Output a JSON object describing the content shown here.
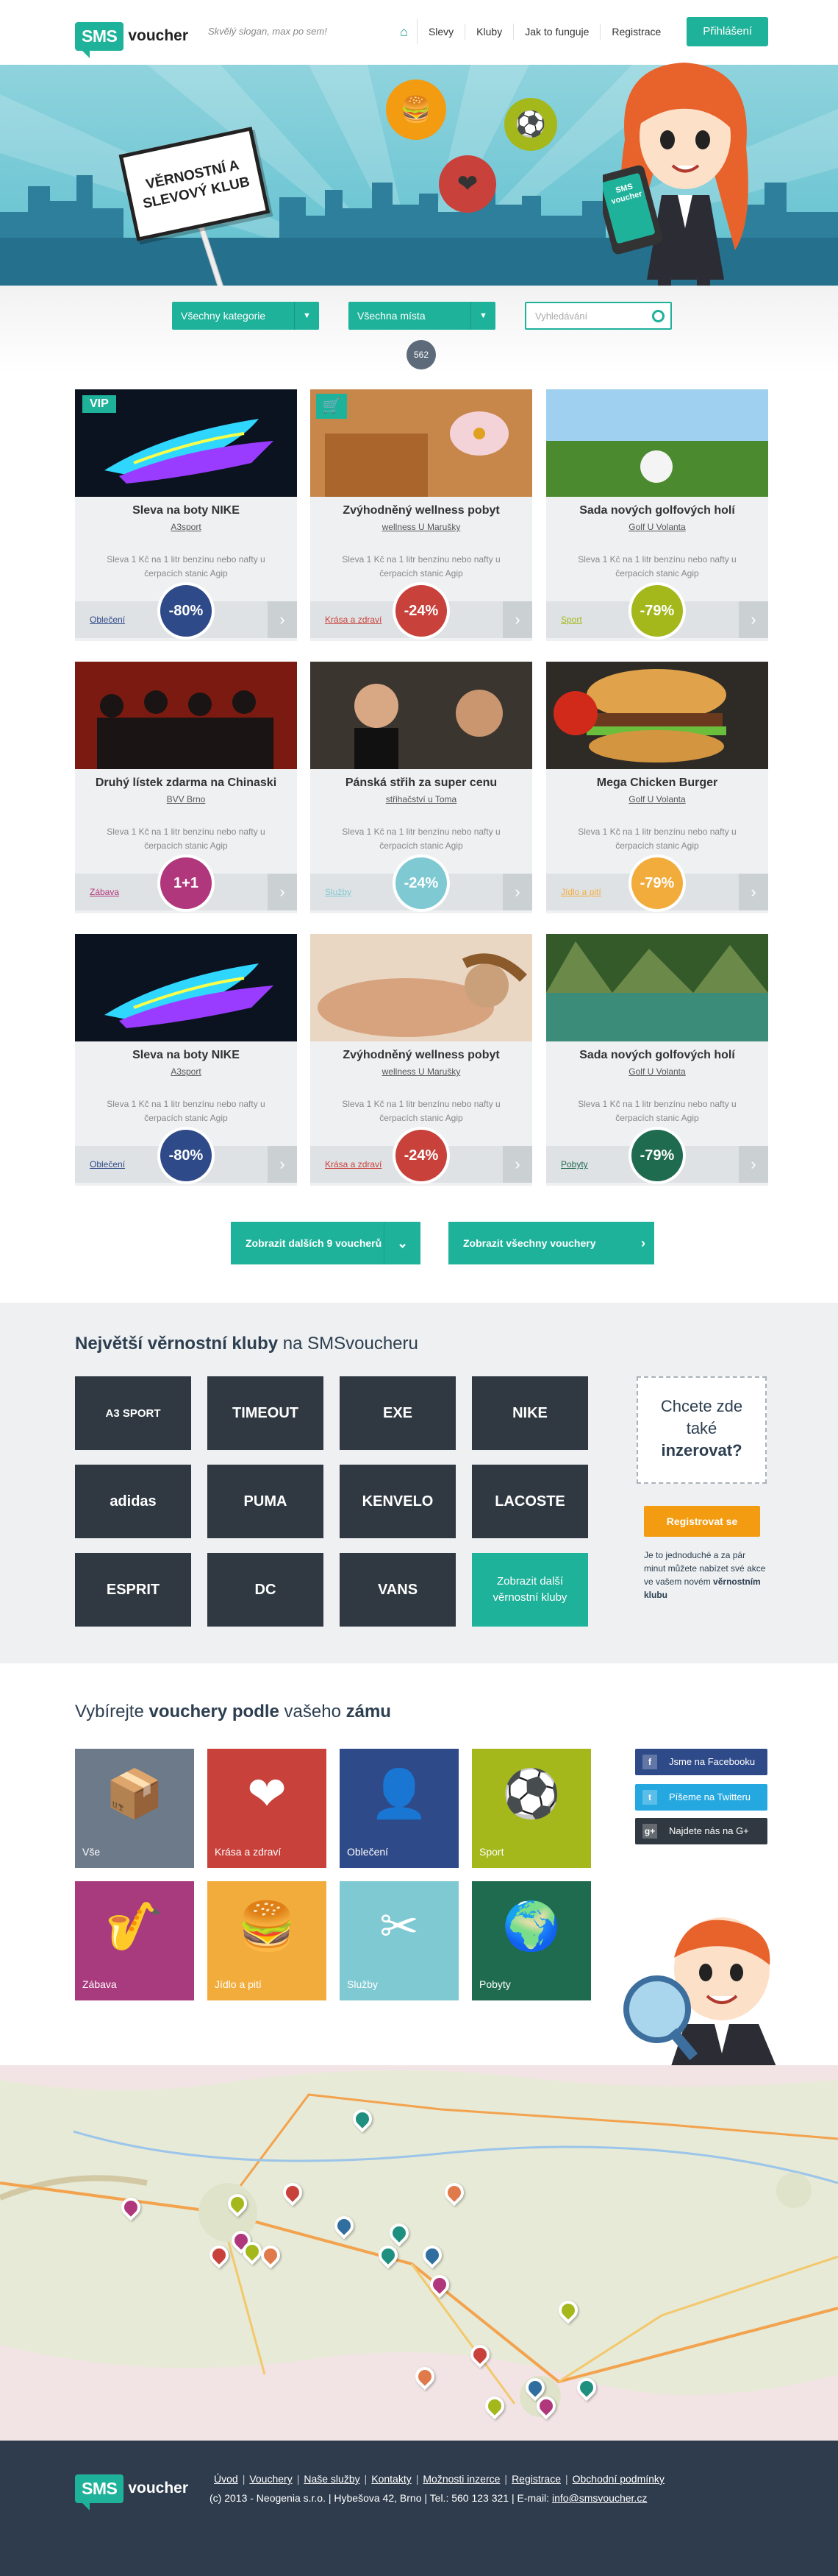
{
  "header": {
    "logo_sms": "SMS",
    "logo_voucher": "voucher",
    "slogan": "Skvělý slogan, max po sem!",
    "nav": [
      "Slevy",
      "Kluby",
      "Jak to funguje",
      "Registrace"
    ],
    "login": "Přihlášení"
  },
  "hero": {
    "sign_line1": "VĚRNOSTNÍ A",
    "sign_line2": "SLEVOVÝ KLUB",
    "phone_sms": "SMS",
    "phone_voucher": "voucher"
  },
  "filters": {
    "categories": "Všechny kategorie",
    "places": "Všechna místa",
    "search_placeholder": "Vyhledávání",
    "count": "562"
  },
  "cards": [
    {
      "title": "Sleva na boty NIKE",
      "shop": "A3sport",
      "desc": "Sleva 1 Kč na 1 litr benzínu nebo nafty u čerpacích stanic Agip",
      "category": "Oblečení",
      "discount": "-80%",
      "color": "#2f4a88",
      "badge": "VIP",
      "img": "nike"
    },
    {
      "title": "Zvýhodněný wellness pobyt",
      "shop": "wellness U Marušky",
      "desc": "Sleva 1 Kč na 1 litr benzínu nebo nafty u čerpacích stanic Agip",
      "category": "Krása a zdraví",
      "discount": "-24%",
      "color": "#c8413b",
      "badge": "cart",
      "img": "spa"
    },
    {
      "title": "Sada nových golfových holí",
      "shop": "Golf U Volanta",
      "desc": "Sleva 1 Kč na 1 litr benzínu nebo nafty u čerpacích stanic Agip",
      "category": "Sport",
      "discount": "-79%",
      "color": "#a4b81c",
      "badge": "",
      "img": "golf"
    },
    {
      "title": "Druhý lístek zdarma na Chinaski",
      "shop": "BVV Brno",
      "desc": "Sleva 1 Kč na 1 litr benzínu nebo nafty u čerpacích stanic Agip",
      "category": "Zábava",
      "discount": "1+1",
      "color": "#b1377d",
      "badge": "",
      "img": "band"
    },
    {
      "title": "Pánská střih za super cenu",
      "shop": "střihačství u Toma",
      "desc": "Sleva 1 Kč na 1 litr benzínu nebo nafty u čerpacích stanic Agip",
      "category": "Služby",
      "discount": "-24%",
      "color": "#7fc9d3",
      "badge": "",
      "img": "barber"
    },
    {
      "title": "Mega Chicken Burger",
      "shop": "Golf U Volanta",
      "desc": "Sleva 1 Kč na 1 litr benzínu nebo nafty u čerpacích stanic Agip",
      "category": "Jídlo a pití",
      "discount": "-79%",
      "color": "#f2ac3c",
      "badge": "",
      "img": "burger"
    },
    {
      "title": "Sleva na boty NIKE",
      "shop": "A3sport",
      "desc": "Sleva 1 Kč na 1 litr benzínu nebo nafty u čerpacích stanic Agip",
      "category": "Oblečení",
      "discount": "-80%",
      "color": "#2f4a88",
      "badge": "",
      "img": "nike"
    },
    {
      "title": "Zvýhodněný wellness pobyt",
      "shop": "wellness U Marušky",
      "desc": "Sleva 1 Kč na 1 litr benzínu nebo nafty u čerpacích stanic Agip",
      "category": "Krása a zdraví",
      "discount": "-24%",
      "color": "#c8413b",
      "badge": "",
      "img": "massage"
    },
    {
      "title": "Sada nových golfových holí",
      "shop": "Golf U Volanta",
      "desc": "Sleva 1 Kč na 1 litr benzínu nebo nafty u čerpacích stanic Agip",
      "category": "Pobyty",
      "discount": "-79%",
      "color": "#1f6b4f",
      "badge": "",
      "img": "lake"
    }
  ],
  "buttons": {
    "more": "Zobrazit dalších 9 voucherů",
    "all": "Zobrazit všechny vouchery"
  },
  "clubs": {
    "title_bold": "Největší věrnostní kluby",
    "title_rest": " na SMSvoucheru",
    "brands": [
      "A3 SPORT",
      "TIMEOUT",
      "EXE",
      "NIKE",
      "adidas",
      "PUMA",
      "KENVELO",
      "LACOSTE",
      "ESPRIT",
      "DC",
      "VANS"
    ],
    "more": "Zobrazit další věrnostní kluby",
    "ad_q1": "Chcete zde",
    "ad_q2": "také",
    "ad_q3": "inzerovat?",
    "register": "Registrovat se",
    "ad_text": "Je to jednoduché a za pár minut můžete nabízet své akce ve vašem novém",
    "ad_text_bold": "věrnostním klubu"
  },
  "categories": {
    "title_a": "Vybírejte ",
    "title_b": "vouchery podle",
    "title_c": " vašeho ",
    "title_d": "zámu",
    "tiles": [
      {
        "label": "Vše",
        "color": "#6c7a8a",
        "icon": "box-icon"
      },
      {
        "label": "Krása a zdraví",
        "color": "#c8413b",
        "icon": "heart-icon"
      },
      {
        "label": "Oblečení",
        "color": "#2f4a88",
        "icon": "person-icon"
      },
      {
        "label": "Sport",
        "color": "#a4b81c",
        "icon": "ball-icon"
      },
      {
        "label": "Zábava",
        "color": "#a83a7e",
        "icon": "sax-icon"
      },
      {
        "label": "Jídlo a pití",
        "color": "#f2ac3c",
        "icon": "burger-icon"
      },
      {
        "label": "Služby",
        "color": "#7fc9d3",
        "icon": "scissors-icon"
      },
      {
        "label": "Pobyty",
        "color": "#1f6b4f",
        "icon": "globe-icon"
      }
    ]
  },
  "social": {
    "facebook": "Jsme na Facebooku",
    "twitter": "Píšeme na Twitteru",
    "google": "Najdete nás na G+"
  },
  "footer": {
    "links": [
      "Úvod",
      "Vouchery",
      "Naše služby",
      "Kontakty",
      "Možnosti inzerce",
      "Registrace",
      "Obchodní podmínky"
    ],
    "copy": "(c) 2013 - Neogenia s.r.o.",
    "address": "Hybešova 42, Brno",
    "phone": "Tel.: 560 123 321",
    "email_label": "E-mail:",
    "email": "info@smsvoucher.cz"
  }
}
